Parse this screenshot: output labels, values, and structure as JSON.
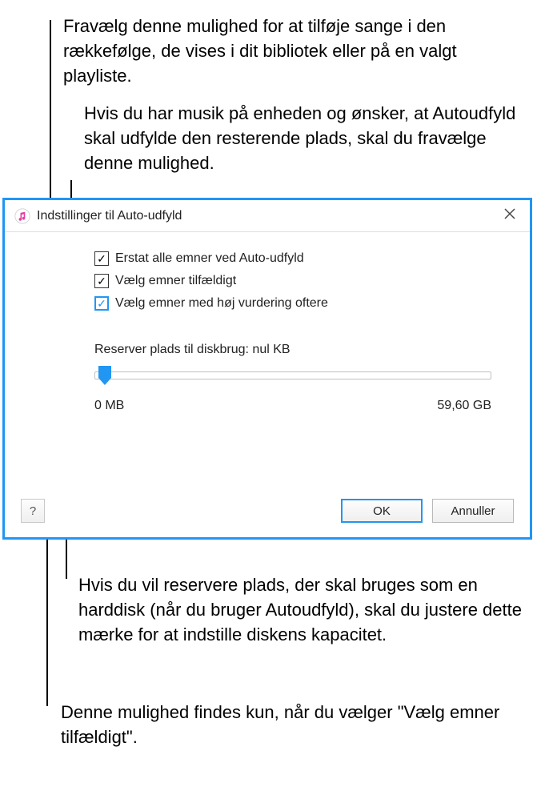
{
  "annotations": {
    "a1": "Fravælg denne mulighed for at tilføje sange i den rækkefølge, de vises i dit bibliotek eller på en valgt playliste.",
    "a2": "Hvis du har musik på enheden og ønsker, at Autoudfyld skal udfylde den resterende plads, skal du fravælge denne mulighed.",
    "a3": "Hvis du vil reservere plads, der skal bruges som en harddisk (når du bruger Autoudfyld), skal du justere dette mærke for at indstille diskens kapacitet.",
    "a4": "Denne mulighed findes kun, når du vælger \"Vælg emner tilfældigt\"."
  },
  "dialog": {
    "title": "Indstillinger til Auto-udfyld",
    "checkboxes": {
      "replace_all": "Erstat alle emner ved Auto-udfyld",
      "random": "Vælg emner tilfældigt",
      "high_rating": "Vælg emner med høj vurdering oftere"
    },
    "slider": {
      "label": "Reserver plads til diskbrug: nul KB",
      "min_label": "0 MB",
      "max_label": "59,60 GB"
    },
    "buttons": {
      "ok": "OK",
      "cancel": "Annuller",
      "help": "?"
    }
  }
}
